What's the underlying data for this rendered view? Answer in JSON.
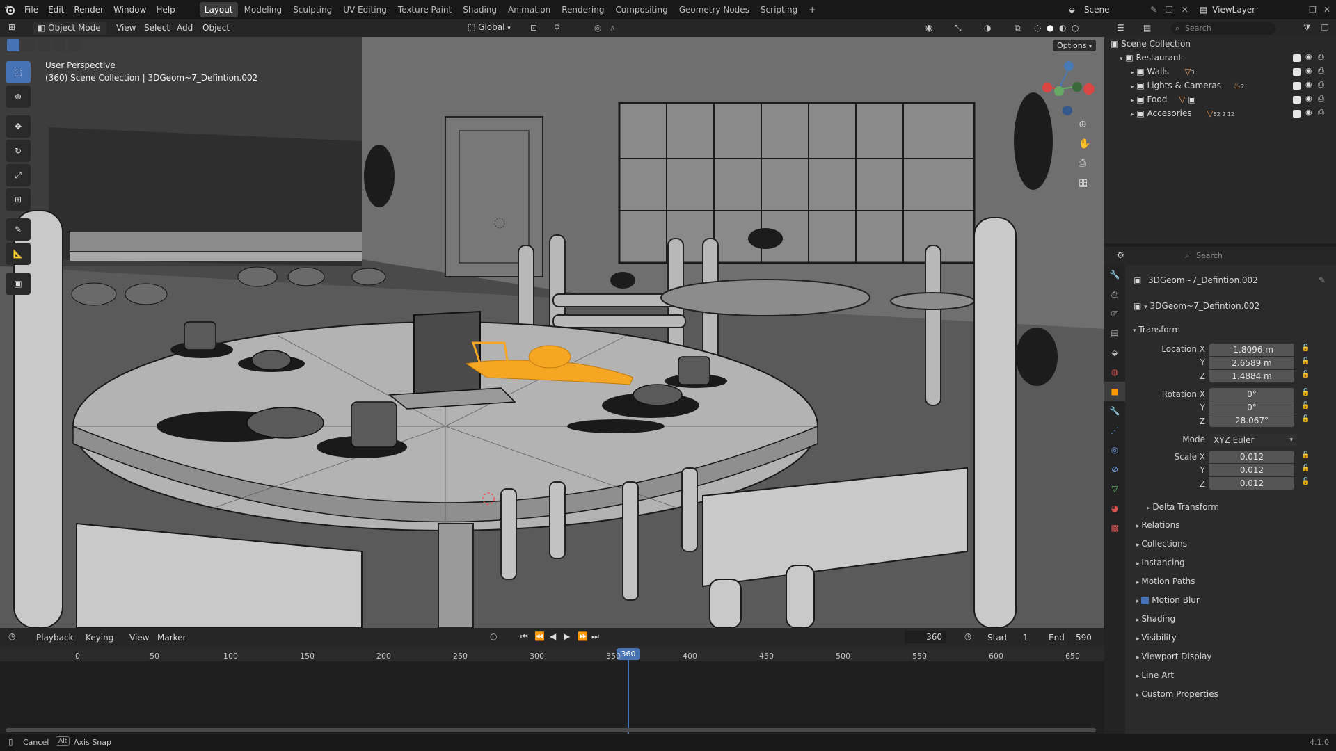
{
  "app": {
    "version": "4.1.0"
  },
  "menu": {
    "file": "File",
    "edit": "Edit",
    "render": "Render",
    "window": "Window",
    "help": "Help"
  },
  "workspaces": [
    "Layout",
    "Modeling",
    "Sculpting",
    "UV Editing",
    "Texture Paint",
    "Shading",
    "Animation",
    "Rendering",
    "Compositing",
    "Geometry Nodes",
    "Scripting"
  ],
  "workspace_add": "+",
  "scene": {
    "name": "Scene",
    "view_layer": "ViewLayer"
  },
  "viewport_header": {
    "mode": "Object Mode",
    "view": "View",
    "select": "Select",
    "add": "Add",
    "object": "Object",
    "orientation": "Global",
    "options": "Options"
  },
  "viewport": {
    "perspective": "User Perspective",
    "info": "(360) Scene Collection | 3DGeom~7_Defintion.002"
  },
  "outliner": {
    "search_placeholder": "Search",
    "root": "Scene Collection",
    "collection": "Restaurant",
    "children": [
      {
        "name": "Walls",
        "count": "3"
      },
      {
        "name": "Lights & Cameras",
        "count": "2"
      },
      {
        "name": "Food",
        "count": ""
      },
      {
        "name": "Accesories",
        "count": "62 2 12"
      }
    ]
  },
  "properties": {
    "search_placeholder": "Search",
    "object_name": "3DGeom~7_Defintion.002",
    "datablock_name": "3DGeom~7_Defintion.002",
    "transform_title": "Transform",
    "location_label": "Location X",
    "location": {
      "x": "-1.8096 m",
      "y": "2.6589 m",
      "z": "1.4884 m"
    },
    "rotation_label": "Rotation X",
    "rotation": {
      "x": "0°",
      "y": "0°",
      "z": "28.067°"
    },
    "mode_label": "Mode",
    "mode_value": "XYZ Euler",
    "scale_label": "Scale X",
    "scale": {
      "x": "0.012",
      "y": "0.012",
      "z": "0.012"
    },
    "axis_y": "Y",
    "axis_z": "Z",
    "delta_transform": "Delta Transform",
    "panels": [
      "Relations",
      "Collections",
      "Instancing",
      "Motion Paths",
      "Motion Blur",
      "Shading",
      "Visibility",
      "Viewport Display",
      "Line Art",
      "Custom Properties"
    ]
  },
  "timeline": {
    "playback": "Playback",
    "keying": "Keying",
    "view": "View",
    "marker": "Marker",
    "current_frame": "360",
    "start_label": "Start",
    "start": "1",
    "end_label": "End",
    "end": "590",
    "ticks": [
      "0",
      "50",
      "100",
      "150",
      "200",
      "250",
      "300",
      "350",
      "400",
      "450",
      "500",
      "550",
      "600",
      "650"
    ]
  },
  "status": {
    "cancel": "Cancel",
    "alt_key": "Alt",
    "axis_snap": "Axis Snap"
  },
  "colors": {
    "accent": "#4772b3",
    "selection": "#f5a623",
    "wireframe": "#111111"
  }
}
